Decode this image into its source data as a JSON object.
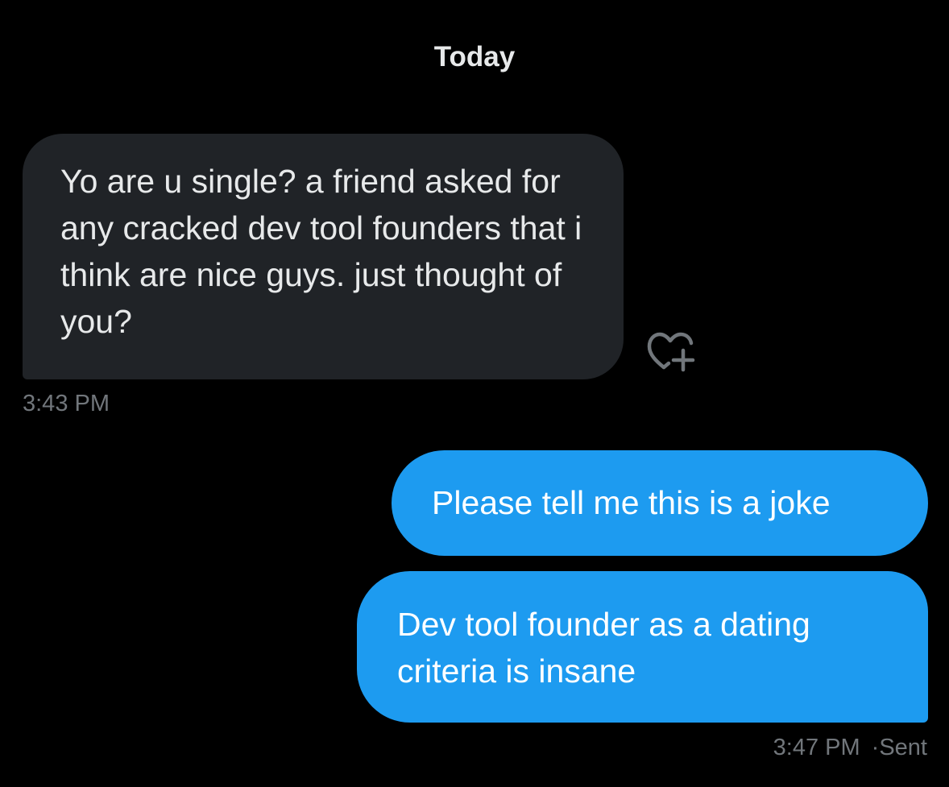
{
  "conversation": {
    "date_label": "Today",
    "messages": [
      {
        "direction": "incoming",
        "text": "Yo are u single? a friend asked for any cracked dev tool founders that i think are nice guys. just thought of you?",
        "time": "3:43 PM"
      },
      {
        "direction": "outgoing",
        "text": "Please tell me this is a joke"
      },
      {
        "direction": "outgoing",
        "text": "Dev tool founder as a dating criteria is insane",
        "time": "3:47 PM",
        "status": "Sent"
      }
    ]
  },
  "icons": {
    "react": "heart-plus-icon"
  },
  "colors": {
    "background": "#000000",
    "incoming_bubble": "#202327",
    "outgoing_bubble": "#1d9bf0",
    "primary_text": "#e7e9ea",
    "secondary_text": "#71767b"
  }
}
